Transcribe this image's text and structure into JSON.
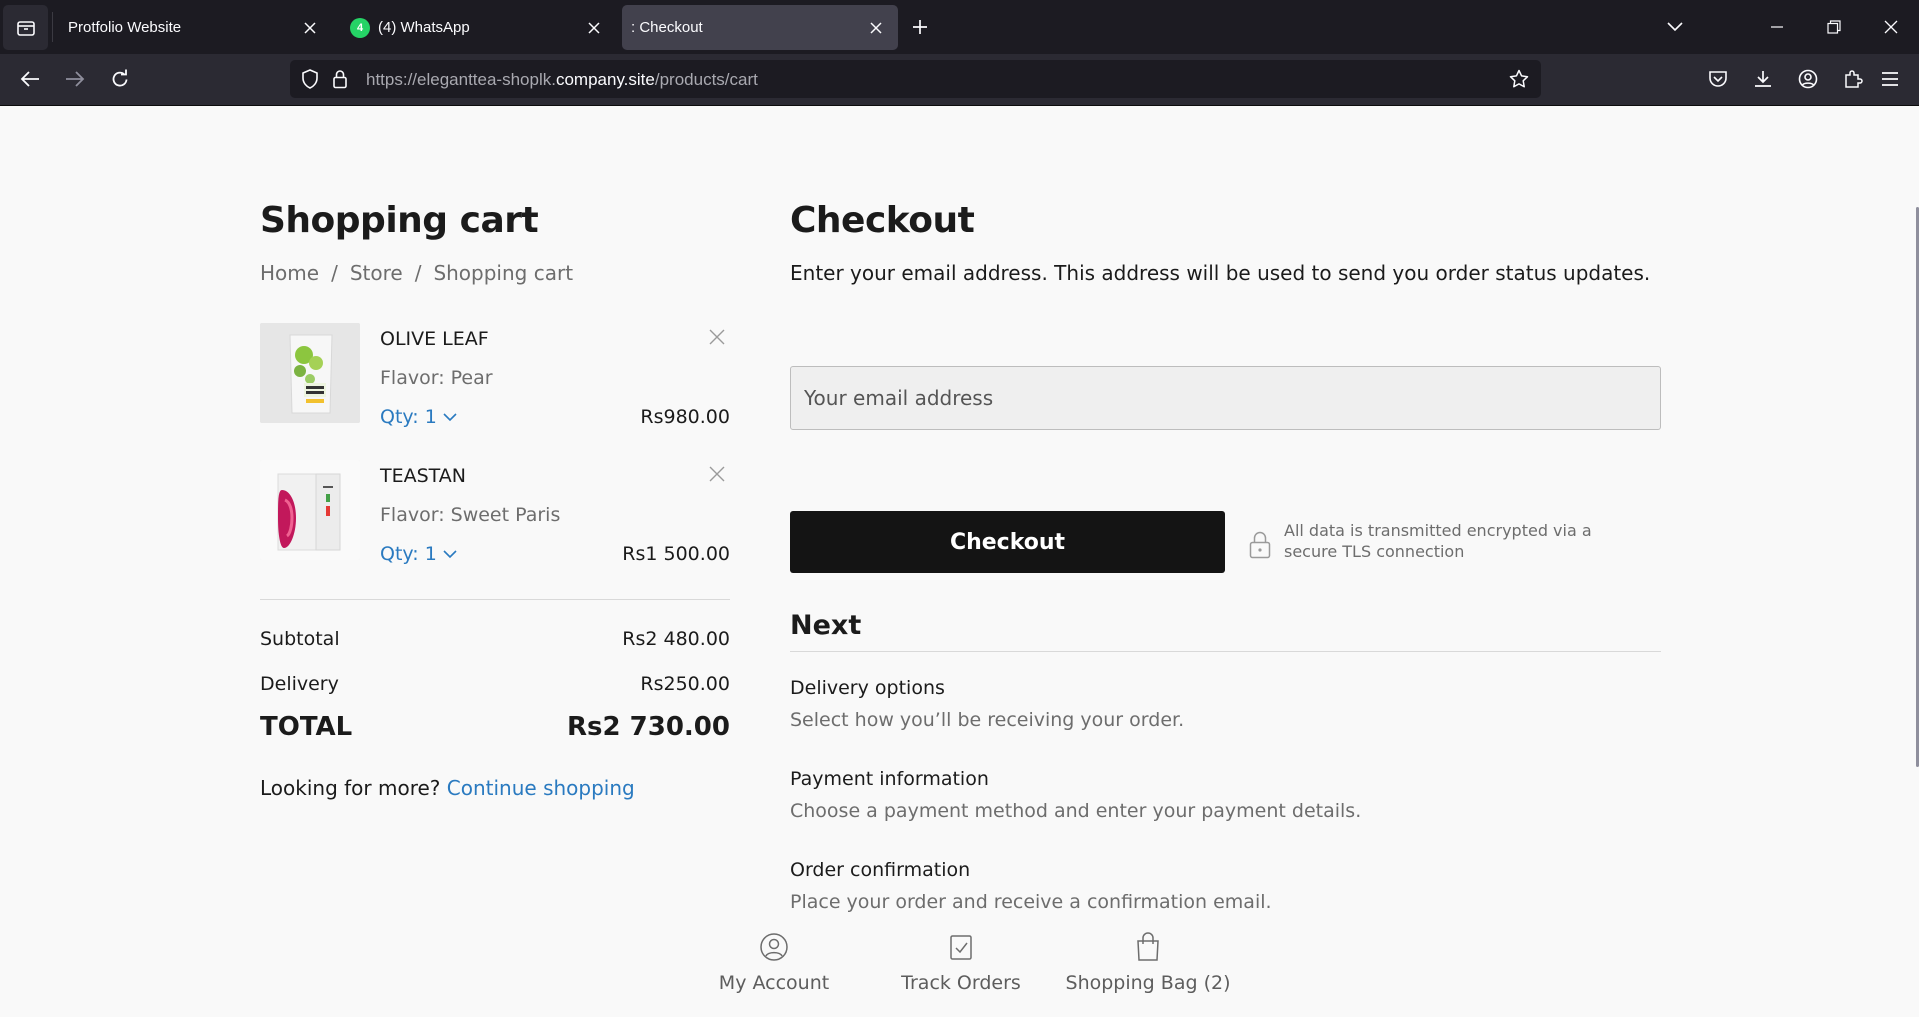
{
  "browser": {
    "tabs": [
      {
        "title": "Protfolio Website",
        "active": false
      },
      {
        "title": "(4) WhatsApp",
        "active": false,
        "badge": "4"
      },
      {
        "title": ": Checkout",
        "active": true
      }
    ],
    "url": {
      "prefix": "https://eleganttea-shoplk.",
      "domain": "company.site",
      "path": "/products/cart"
    }
  },
  "cart": {
    "title": "Shopping cart",
    "breadcrumb": [
      "Home",
      "Store",
      "Shopping cart"
    ],
    "items": [
      {
        "name": "OLIVE LEAF",
        "flavor": "Flavor: Pear",
        "qty": "Qty: 1",
        "price": "Rs980.00"
      },
      {
        "name": "TEASTAN",
        "flavor": "Flavor: Sweet Paris",
        "qty": "Qty: 1",
        "price": "Rs1 500.00"
      }
    ],
    "subtotal_label": "Subtotal",
    "subtotal": "Rs2 480.00",
    "delivery_label": "Delivery",
    "delivery": "Rs250.00",
    "total_label": "TOTAL",
    "total": "Rs2 730.00",
    "more_text": "Looking for more?",
    "continue_link": "Continue shopping"
  },
  "checkout": {
    "title": "Checkout",
    "intro": "Enter your email address. This address will be used to send you order status updates.",
    "email_placeholder": "Your email address",
    "button": "Checkout",
    "secure_note": "All data is transmitted encrypted via a secure TLS connection",
    "next_title": "Next",
    "steps": [
      {
        "title": "Delivery options",
        "desc": "Select how you’ll be receiving your order."
      },
      {
        "title": "Payment information",
        "desc": "Choose a payment method and enter your payment details."
      },
      {
        "title": "Order confirmation",
        "desc": "Place your order and receive a confirmation email."
      }
    ]
  },
  "footer": {
    "links": [
      {
        "label": "My Account",
        "icon": "user-circle-icon"
      },
      {
        "label": "Track Orders",
        "icon": "clipboard-check-icon"
      },
      {
        "label": "Shopping Bag (2)",
        "icon": "shopping-bag-icon"
      }
    ]
  },
  "colors": {
    "link": "#2a7ac0",
    "button": "#141414",
    "chrome_dark": "#1c1b22",
    "chrome_mid": "#2b2a33"
  }
}
